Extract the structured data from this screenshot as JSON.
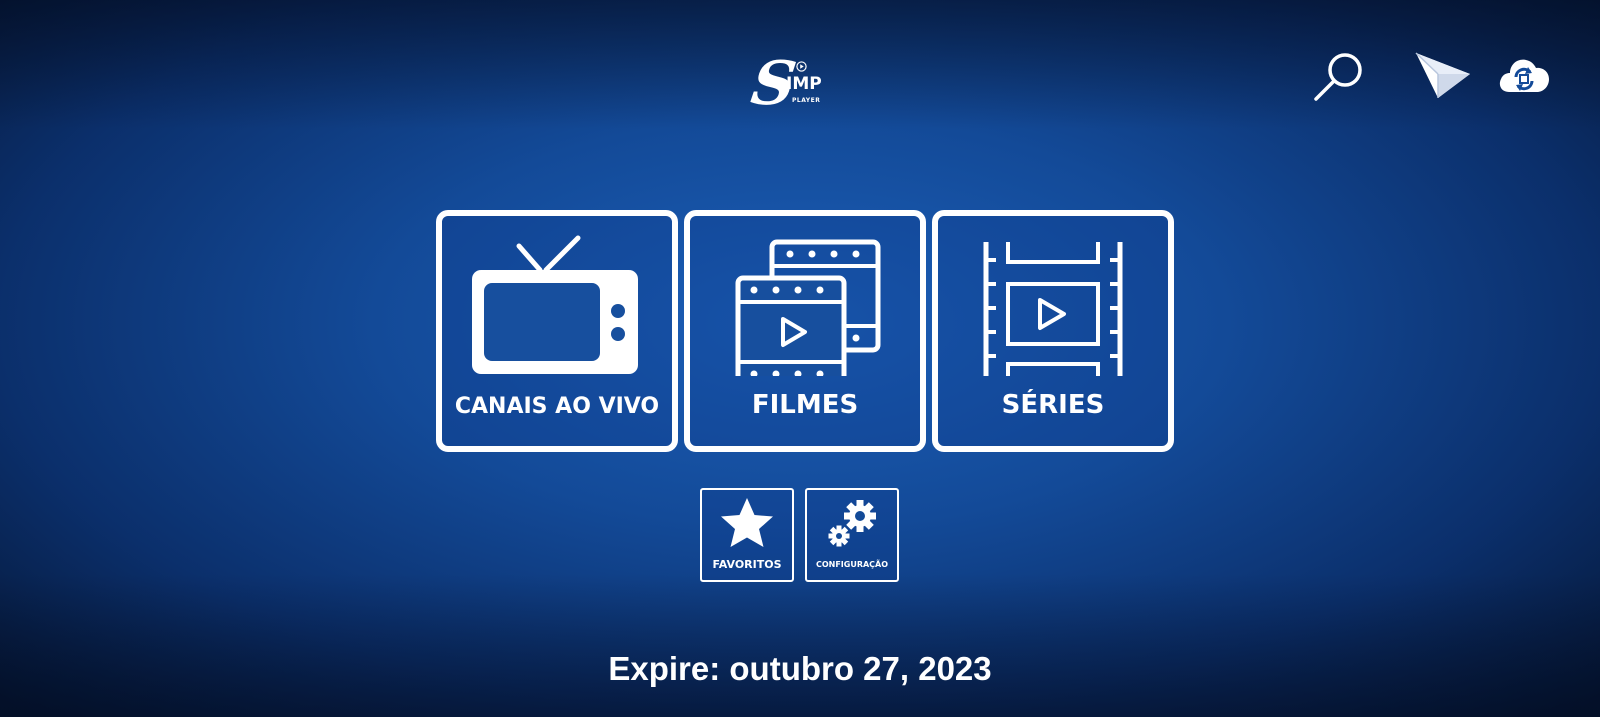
{
  "app": {
    "logo_letter": "S",
    "logo_text": "IMP",
    "logo_sub": "PLAYER"
  },
  "toolbar": {
    "icons": [
      "search-icon",
      "send-icon",
      "cloud-sync-icon"
    ]
  },
  "tiles": [
    {
      "label": "CANAIS AO VIVO",
      "icon": "tv-icon"
    },
    {
      "label": "FILMES",
      "icon": "film-icon"
    },
    {
      "label": "SÉRIES",
      "icon": "filmstrip-icon"
    }
  ],
  "shortcuts": [
    {
      "label": "FAVORITOS",
      "icon": "star-icon"
    },
    {
      "label": "CONFIGURAÇÃO",
      "icon": "gears-icon"
    }
  ],
  "footer": {
    "expire_text": "Expire: outubro 27, 2023"
  },
  "colors": {
    "background": "#134a98",
    "foreground": "#ffffff"
  }
}
